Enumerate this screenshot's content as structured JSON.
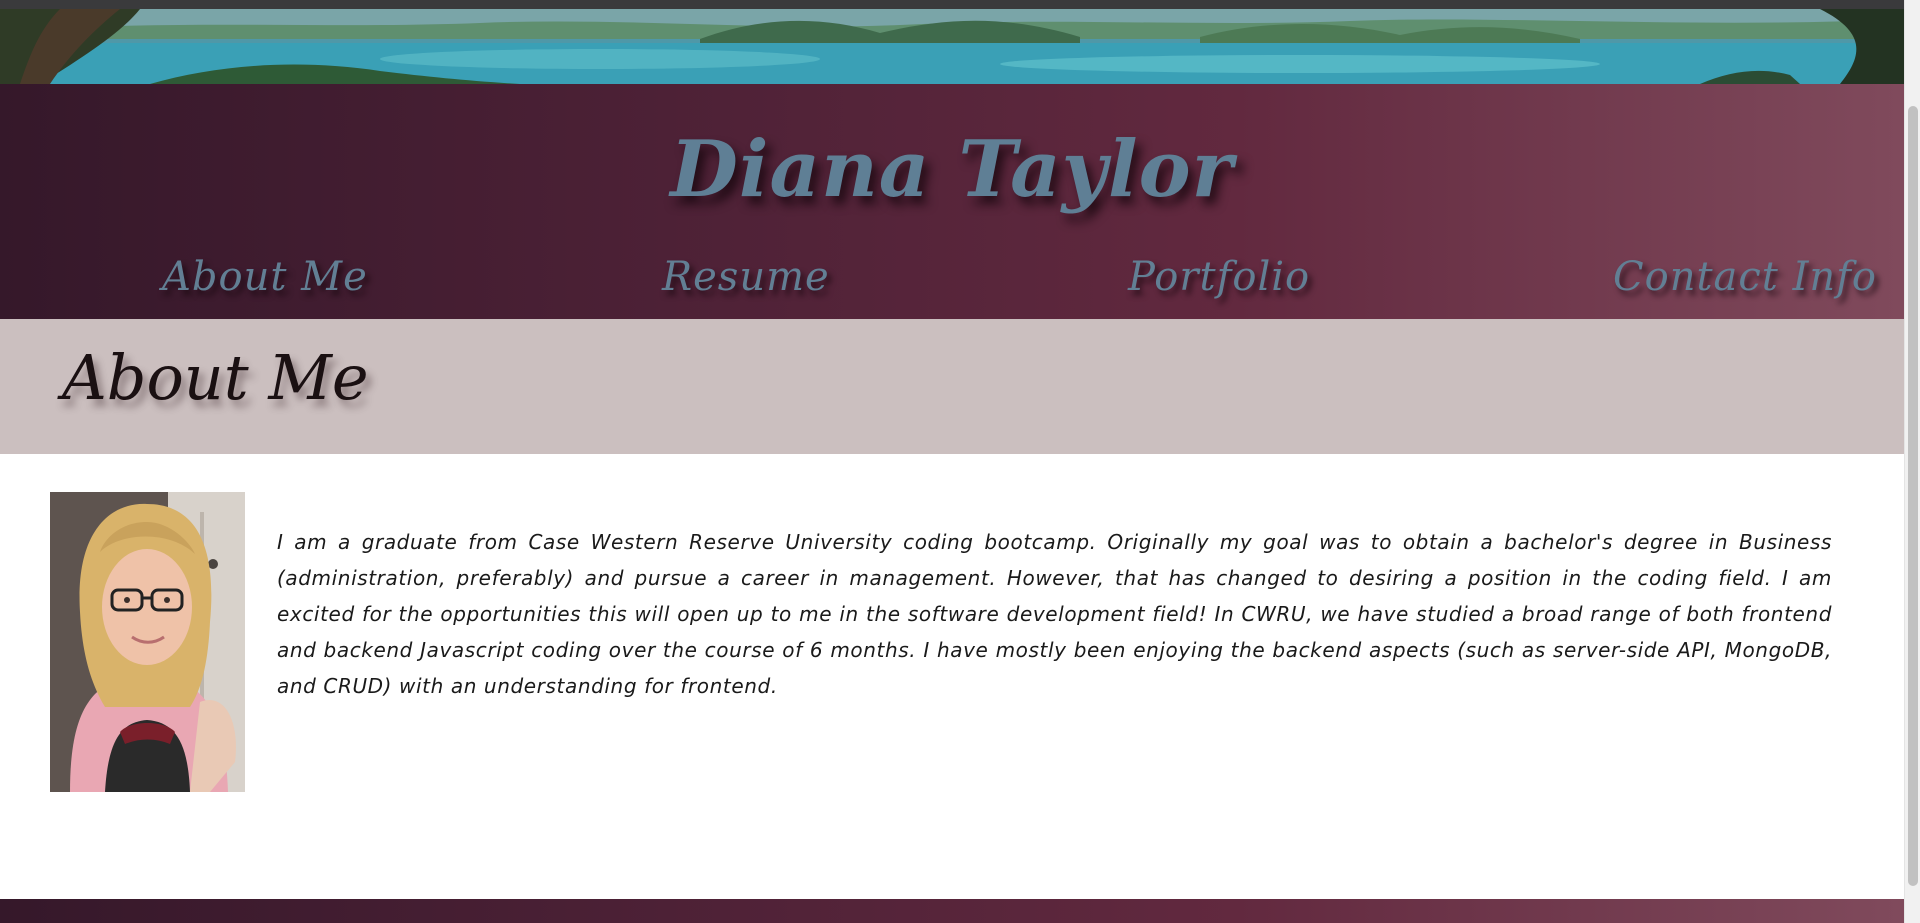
{
  "site": {
    "name": "Diana Taylor"
  },
  "nav": {
    "items": [
      {
        "label": "About Me"
      },
      {
        "label": "Resume"
      },
      {
        "label": "Portfolio"
      },
      {
        "label": "Contact Info"
      }
    ]
  },
  "section": {
    "title": "About Me"
  },
  "about": {
    "bio": "I am a graduate from Case Western Reserve University coding bootcamp. Originally my goal was to obtain a bachelor's degree in Business (administration, preferably) and pursue a career in management. However, that has changed to desiring a position in the coding field. I am excited for the opportunities this will open up to me in the software development field! In CWRU, we have studied a broad range of both frontend and backend Javascript coding over the course of 6 months. I have mostly been enjoying the backend aspects (such as server-side API, MongoDB, and CRUD) with an understanding for frontend."
  },
  "colors": {
    "header_gradient_start": "#35182a",
    "header_gradient_end": "#804a5c",
    "title_color": "#5f7f95",
    "section_bar": "#cbbfbf"
  }
}
